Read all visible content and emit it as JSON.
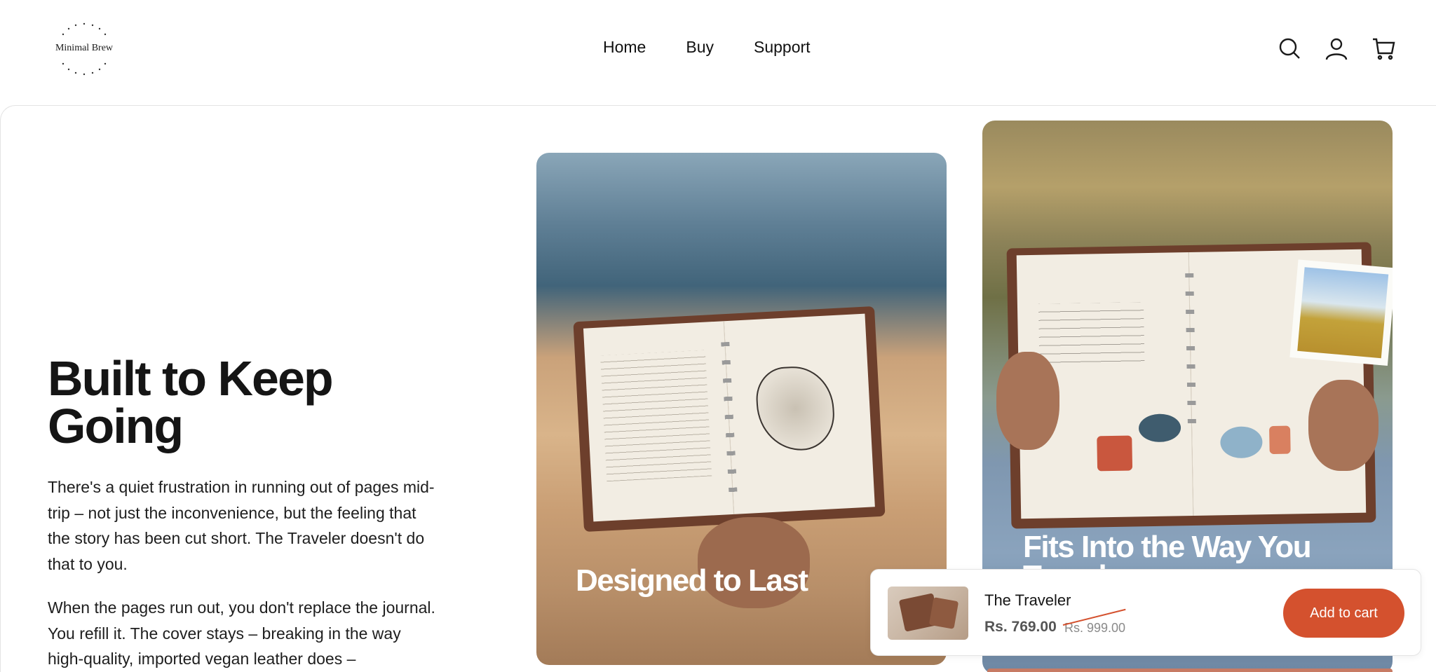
{
  "header": {
    "logo_text": "Minimal Brew",
    "nav": [
      {
        "label": "Home"
      },
      {
        "label": "Buy"
      },
      {
        "label": "Support"
      }
    ],
    "icons": [
      "search-icon",
      "account-icon",
      "cart-icon"
    ]
  },
  "hero": {
    "title": "Built to Keep Going",
    "paragraph_1": "There's a quiet frustration in running out of pages mid-trip – not just the inconvenience, but the feeling that the story has been cut short. The Traveler doesn't do that to you.",
    "paragraph_2": "When the pages run out, you don't replace the journal. You refill it. The cover stays – breaking in the way high-quality, imported vegan leather does –"
  },
  "cards": [
    {
      "title": "Designed to Last"
    },
    {
      "title": "Fits Into the Way You Travel"
    }
  ],
  "sticky_cart": {
    "product_name": "The Traveler",
    "price": "Rs. 769.00",
    "compare_price": "Rs. 999.00",
    "button_label": "Add to cart"
  },
  "colors": {
    "accent": "#d4512e",
    "text": "#1a1a1a",
    "border": "#e3e3e3"
  }
}
